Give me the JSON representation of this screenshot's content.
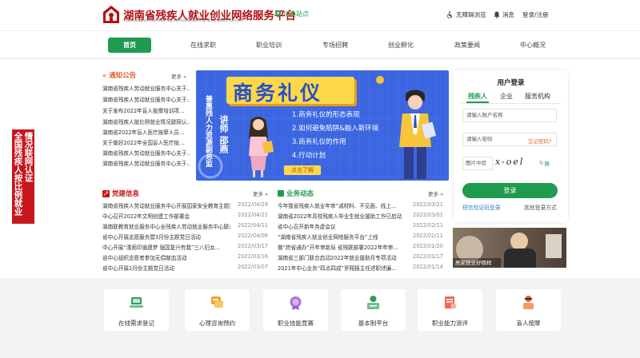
{
  "header": {
    "title": "湖南省残疾人就业创业网络服务平台",
    "subtitle": "HUNAN DISABLED EMPLOYMENT AND ENTREPRENEURSHIP NETWORK SERVICE PLATFORM",
    "switch_site": "切换站点",
    "accessibility": "无障碍浏览",
    "messages": "消息",
    "login_register": "登录/注册"
  },
  "nav": [
    "首页",
    "在线求职",
    "职业培训",
    "专场招聘",
    "创业孵化",
    "政策要闻",
    "中心概况"
  ],
  "notice": {
    "title": "通知公告",
    "more": "更多",
    "items": [
      "湖南省残疾人劳动就业服务中心关于…",
      "湖南省残疾人劳动就业服务中心关于…",
      "关于发布2022年盲人按摩培训项…",
      "湖南省残疾人按比例就业情况联网认…",
      "湖南省2022年盲人医疗按摩人员…",
      "关于做好2022年全国盲人医疗按…",
      "湖南省残疾人劳动就业服务中心关于…",
      "湖南省残疾人劳动就业服务中心关于…"
    ]
  },
  "red_banner": [
    "情况联网认证",
    "全国残疾人按比例就业"
  ],
  "banner": {
    "title": "商务礼仪",
    "speaker_vertical": "讲师 邵燕",
    "side_vertical": "普惠残人力资源副总监",
    "points": [
      "1.商务礼仪的形态表现",
      "2.如何避免陷阱&融入新环境",
      "3.商务礼仪的作用",
      "4.行动计划"
    ],
    "cta": "点击了解"
  },
  "party": {
    "title": "党建信息",
    "more": "更多",
    "items": [
      {
        "t": "湖南省残疾人劳动就业服务中心开展国家安全教育主题宣…",
        "d": "2022/04/29"
      },
      {
        "t": "中心召开2022年文明创建工作部署会",
        "d": "2022/04/21"
      },
      {
        "t": "湖南联教育就业服务中心全残疾人劳动就业服务中心联合…",
        "d": "2022/04/11"
      },
      {
        "t": "省中心开展志愿服务暨3月份主题党日活动",
        "d": "2022/04/08"
      },
      {
        "t": "中心开展“濡雨印循遗梦 强国复兴有我”三八妇女…",
        "d": "2022/03/17"
      },
      {
        "t": "省中心组织志愿者参加无偿献血活动",
        "d": "2022/03/16"
      },
      {
        "t": "省中心开展2月份主题党日活动",
        "d": "2022/03/07"
      }
    ]
  },
  "business": {
    "title": "业务动态",
    "more": "更多",
    "items": [
      {
        "t": "今年我省残疾人就业年审“减材料、不见面、线上…",
        "d": "2022/03/21"
      },
      {
        "t": "湖南省2022年高校残疾人毕业生就业援助工作已启动",
        "d": "2022/03/01"
      },
      {
        "t": "省中心召开新年务虚会议",
        "d": "2022/02/11"
      },
      {
        "t": "“湖南省残疾人就业创业网络服务平台”上线",
        "d": "2022/02/11"
      },
      {
        "t": "做“跨省通办”开年审新局 省残联部署2022年年审…",
        "d": "2022/01/20"
      },
      {
        "t": "湖南省三部门联合启动2022年就业援助月专项活动",
        "d": "2022/01/17"
      },
      {
        "t": "2021年中心业务“四点四成”罗翔报主任述职述廉…",
        "d": "2022/01/14"
      }
    ]
  },
  "login": {
    "title": "用户登录",
    "tabs": [
      "残疾人",
      "企业",
      "服务机构"
    ],
    "account_placeholder": "请输入账户名称",
    "password_placeholder": "请输入密码",
    "forgot": "忘记密码?",
    "captcha_placeholder": "图片中验",
    "captcha_text": "x-oel",
    "refresh": "换",
    "button": "登录",
    "sms_login": "短信验证码登录",
    "other_login": "其他登录方式"
  },
  "promo": {
    "caption": "居家就业好榜样"
  },
  "services": [
    "在线需求登记",
    "心理咨询预约",
    "职业技能竞赛",
    "基本制平台",
    "职业能力测评",
    "盲人按摩"
  ],
  "colors": {
    "brand_red": "#b51016",
    "brand_green": "#1f9b4f",
    "notice_orange": "#e8612c",
    "banner_blue": "#3b66e0"
  }
}
